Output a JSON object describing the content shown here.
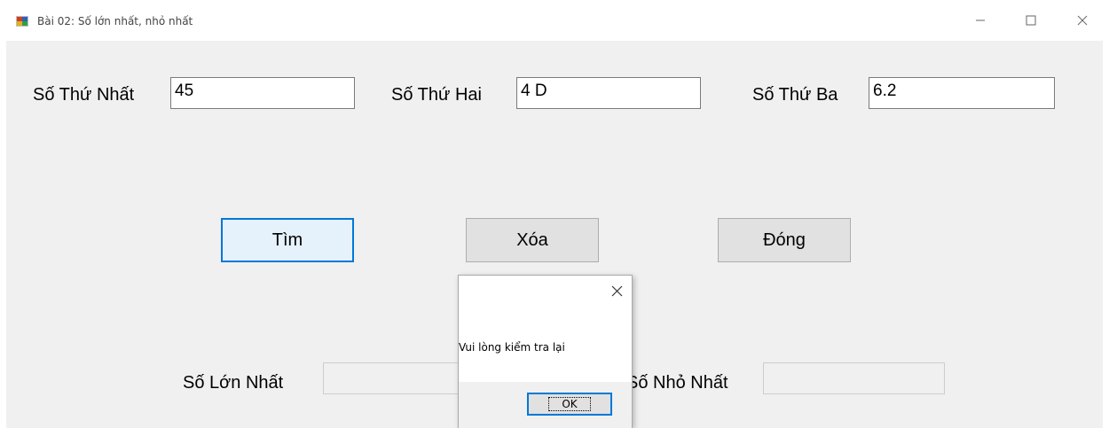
{
  "window": {
    "title": "Bài 02: Số lớn nhất, nhỏ nhất"
  },
  "inputs": {
    "first_label": "Số Thứ Nhất",
    "first_value": "45",
    "second_label": "Số Thứ Hai",
    "second_value": "4 D",
    "third_label": "Số Thứ Ba",
    "third_value": "6.2"
  },
  "buttons": {
    "find": "Tìm",
    "clear": "Xóa",
    "close": "Đóng"
  },
  "results": {
    "max_label": "Số Lớn Nhất",
    "max_value": "",
    "min_label": "Số Nhỏ Nhất",
    "min_value": ""
  },
  "dialog": {
    "message": "Vui lòng kiểm tra lại",
    "ok_label": "OK"
  },
  "colors": {
    "focus": "#0078d7",
    "client_bg": "#f0f0f0"
  }
}
